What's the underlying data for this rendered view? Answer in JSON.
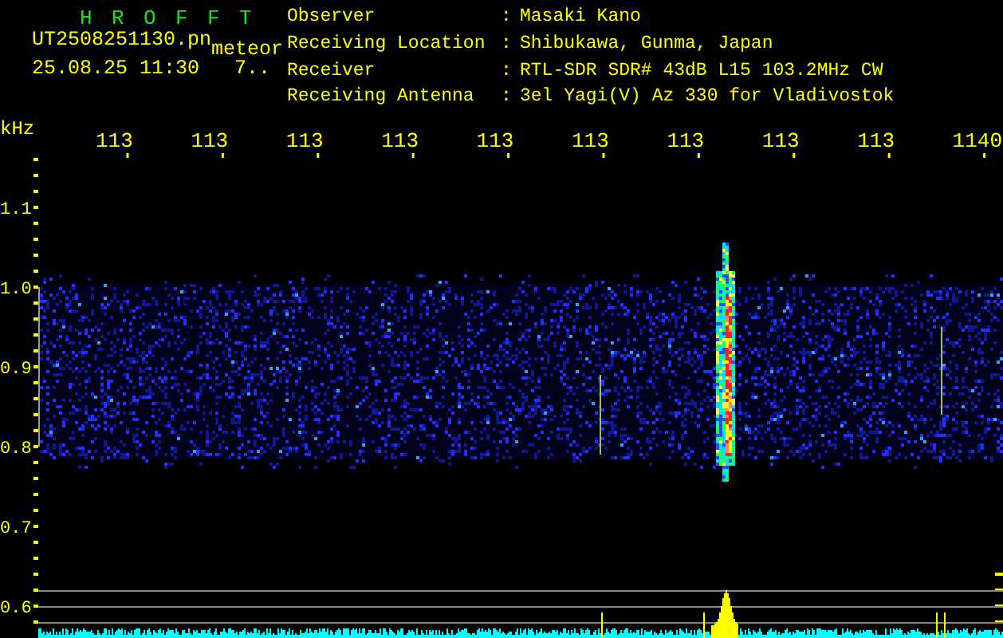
{
  "header": {
    "title": "H R O F F T",
    "filename": "UT2508251130.pn",
    "tag": "meteor",
    "datetime": "25.08.25 11:30",
    "counter": "7.."
  },
  "station": [
    {
      "label": "Observer",
      "colon": ":",
      "value": "Masaki Kano"
    },
    {
      "label": "Receiving Location",
      "colon": ":",
      "value": "Shibukawa, Gunma, Japan"
    },
    {
      "label": "Receiver",
      "colon": ":",
      "value": "RTL-SDR SDR# 43dB L15 103.2MHz CW"
    },
    {
      "label": "Receiving Antenna",
      "colon": ":",
      "value": "3el Yagi(V) Az 330 for Vladivostok"
    }
  ],
  "plot": {
    "y_unit": "kHz",
    "y_labels": [
      "1.1",
      "1.0",
      "0.9",
      "0.8",
      "0.7",
      "0.6"
    ],
    "x_labels": [
      "113",
      "113",
      "113",
      "113",
      "113",
      "113",
      "113",
      "113",
      "113",
      "1140"
    ]
  }
}
